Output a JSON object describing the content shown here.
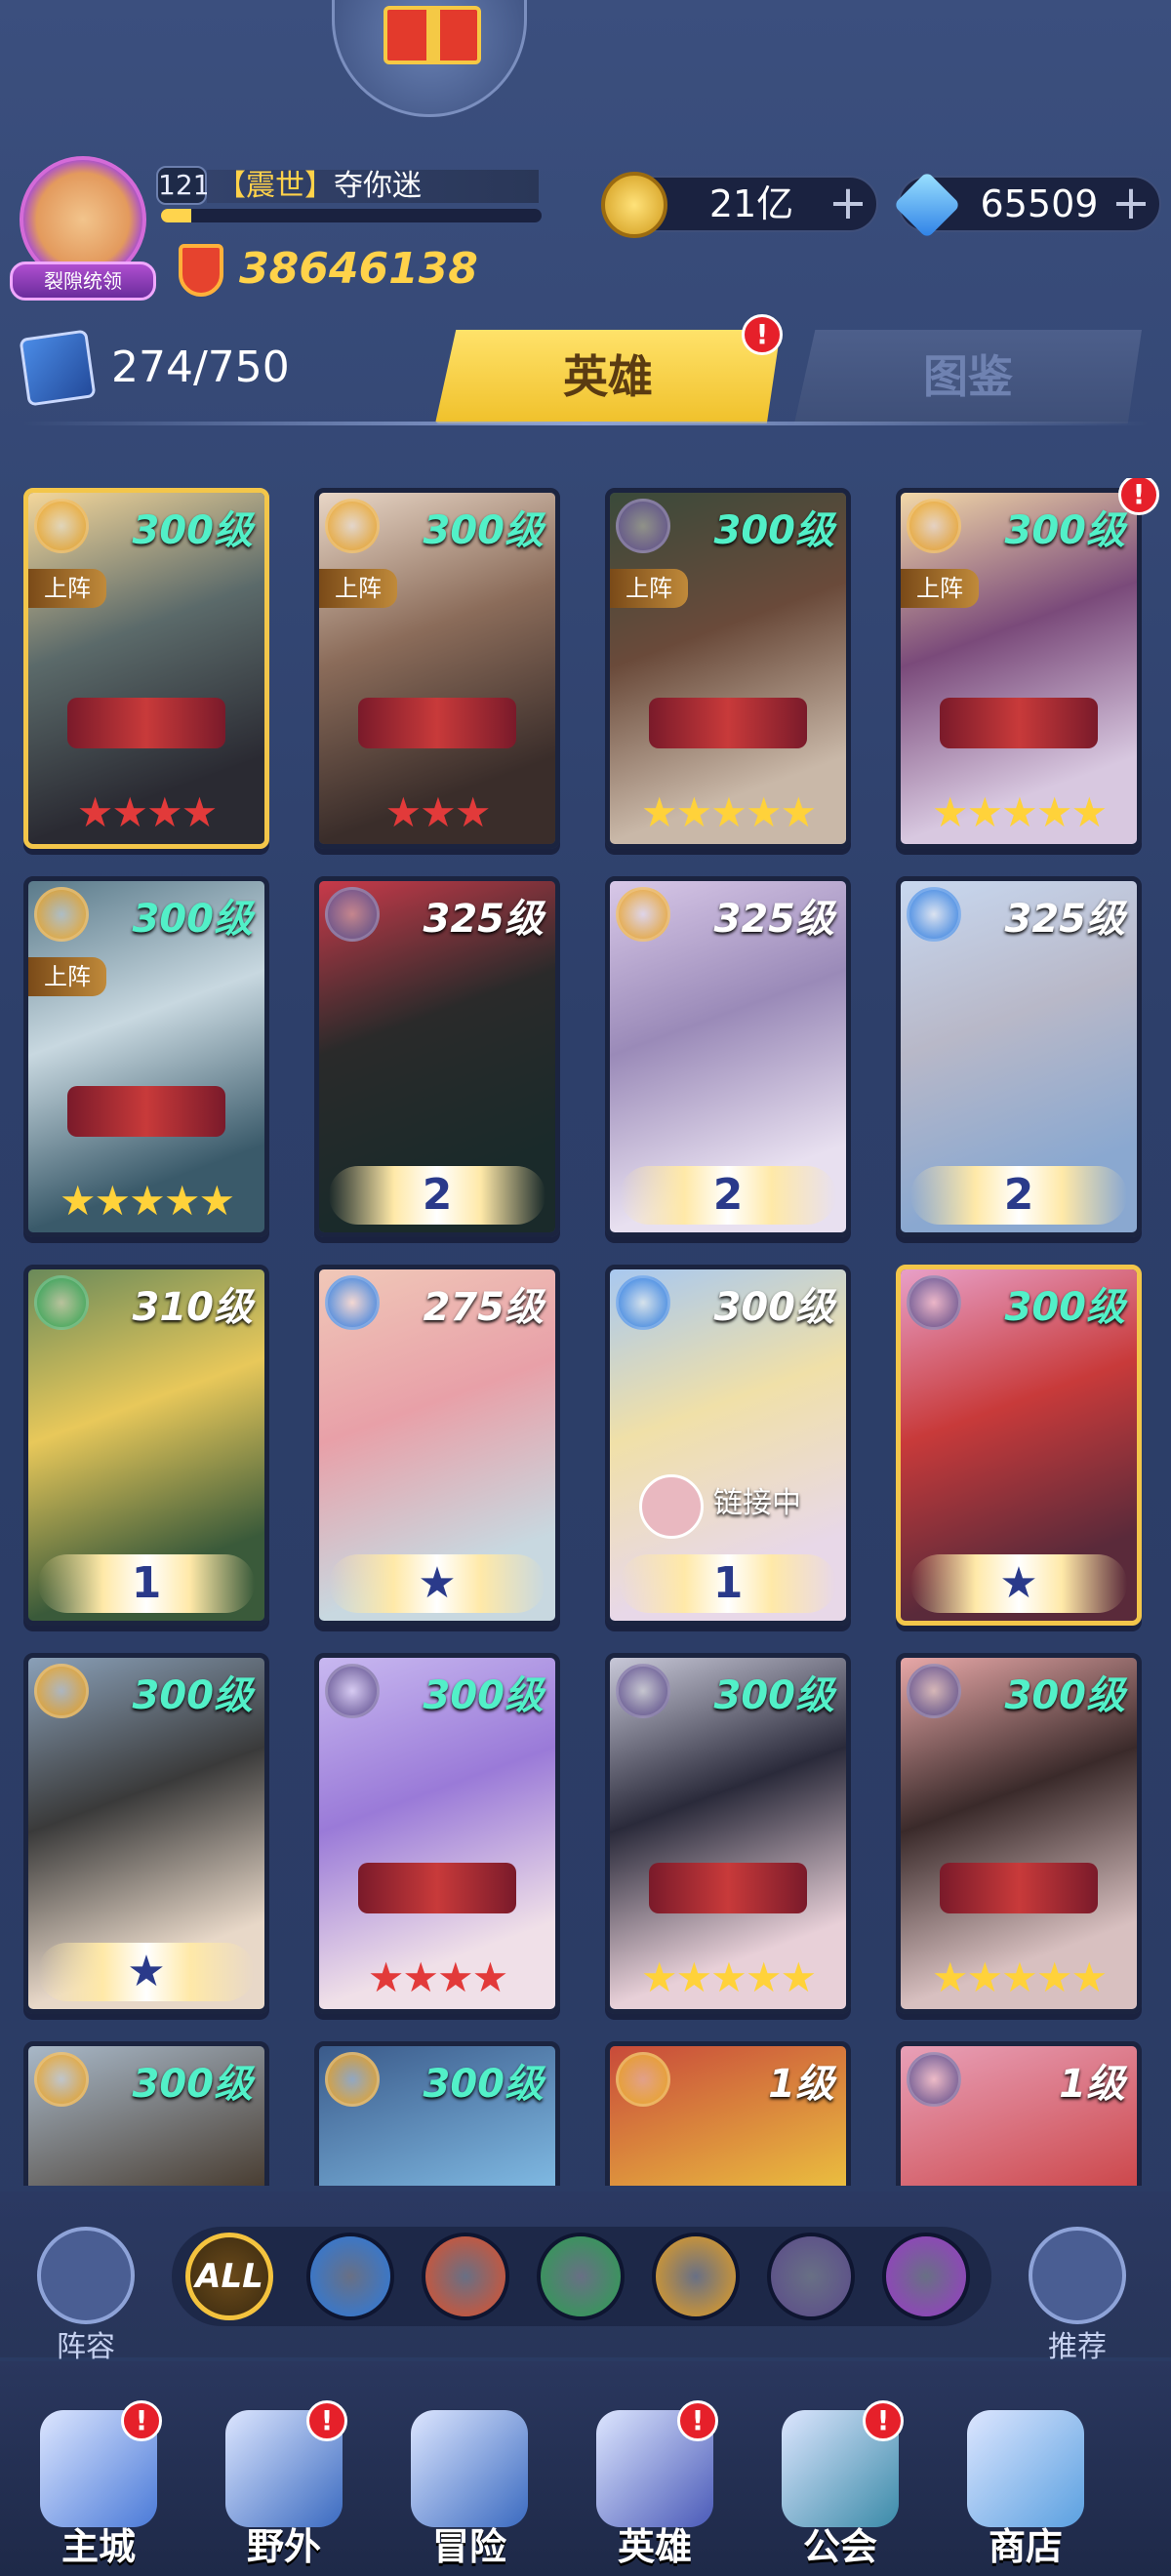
{
  "header": {
    "avatar_title": "裂隙统领",
    "level": "121",
    "guild_tag": "【震世】",
    "player_name": "夺你迷",
    "xp_fraction": 0.08,
    "power": "38646138"
  },
  "resources": {
    "gold": "21亿",
    "diamonds": "65509",
    "plus": "+"
  },
  "collection": {
    "count": "274/750"
  },
  "tabs": {
    "heroes": "英雄",
    "guide": "图鉴",
    "badge": "!"
  },
  "heroes": [
    {
      "level": "300级",
      "element": "light",
      "deployed": "上阵",
      "stars": "★★★★",
      "star_color": "#e23a3a",
      "rank": "",
      "gold_frame": true,
      "badge": false,
      "link": "",
      "art": "linear-gradient(160deg,#f3d69a,#5b6a6a 40%,#2a2a32 80%)",
      "lvl_color": "#52f0c8"
    },
    {
      "level": "300级",
      "element": "light",
      "deployed": "上阵",
      "stars": "★★★",
      "star_color": "#e23a3a",
      "rank": "",
      "gold_frame": false,
      "badge": false,
      "link": "",
      "art": "linear-gradient(160deg,#e8d6c6,#8b6c5a 40%,#3a2d2a 80%)",
      "lvl_color": "#52f0c8"
    },
    {
      "level": "300级",
      "element": "dark",
      "deployed": "上阵",
      "stars": "★★★★★",
      "star_color": "#ffd23a",
      "rank": "",
      "gold_frame": false,
      "badge": false,
      "link": "",
      "art": "linear-gradient(160deg,#3a4a3a,#6a4a3a 40%,#c9b8a8 80%)",
      "lvl_color": "#52f0c8"
    },
    {
      "level": "300级",
      "element": "light",
      "deployed": "上阵",
      "stars": "★★★★★",
      "star_color": "#ffd23a",
      "rank": "",
      "gold_frame": false,
      "badge": true,
      "link": "",
      "art": "linear-gradient(160deg,#f2d8a8,#7a4a7a 40%,#d8c8e0 80%)",
      "lvl_color": "#52f0c8"
    },
    {
      "level": "300级",
      "element": "light",
      "deployed": "上阵",
      "stars": "★★★★★",
      "star_color": "#ffd23a",
      "rank": "",
      "gold_frame": false,
      "badge": false,
      "link": "",
      "art": "linear-gradient(160deg,#5a7a8a,#c8d8e0 40%,#3a5a6a 80%)",
      "lvl_color": "#52f0c8"
    },
    {
      "level": "325级",
      "element": "dark",
      "deployed": "",
      "stars": "",
      "star_color": "",
      "rank": "2",
      "gold_frame": false,
      "badge": false,
      "link": "",
      "art": "linear-gradient(160deg,#c83a4a,#2a2a2a 40%,#1a2a2a 80%)",
      "lvl_color": "#ffffff"
    },
    {
      "level": "325级",
      "element": "light",
      "deployed": "",
      "stars": "",
      "star_color": "",
      "rank": "2",
      "gold_frame": false,
      "badge": false,
      "link": "",
      "art": "linear-gradient(160deg,#d8c8e8,#9a8ab8 40%,#e8e0f0 80%)",
      "lvl_color": "#ffffff"
    },
    {
      "level": "325级",
      "element": "water",
      "deployed": "",
      "stars": "",
      "star_color": "",
      "rank": "2",
      "gold_frame": false,
      "badge": false,
      "link": "",
      "art": "linear-gradient(160deg,#c8d8f0,#b8b8c8 40%,#8aa8d0 80%)",
      "lvl_color": "#ffffff"
    },
    {
      "level": "310级",
      "element": "wind",
      "deployed": "",
      "stars": "",
      "star_color": "",
      "rank": "1",
      "gold_frame": false,
      "badge": false,
      "link": "",
      "art": "linear-gradient(160deg,#6a8a5a,#e8c85a 40%,#3a5a3a 80%)",
      "lvl_color": "#ffffff"
    },
    {
      "level": "275级",
      "element": "water",
      "deployed": "",
      "stars": "",
      "star_color": "",
      "rank": "★",
      "gold_frame": false,
      "badge": false,
      "link": "",
      "art": "linear-gradient(160deg,#f0c8b8,#e8a0a8 40%,#c8d8e0 80%)",
      "lvl_color": "#ffffff"
    },
    {
      "level": "300级",
      "element": "water",
      "deployed": "",
      "stars": "",
      "star_color": "",
      "rank": "1",
      "gold_frame": false,
      "badge": false,
      "link": "链接中",
      "art": "linear-gradient(160deg,#a8c8f0,#f0e0a8 40%,#e8d8e8 80%)",
      "lvl_color": "#ffffff"
    },
    {
      "level": "300级",
      "element": "dark",
      "deployed": "",
      "stars": "",
      "star_color": "",
      "rank": "★",
      "gold_frame": true,
      "badge": false,
      "link": "",
      "art": "linear-gradient(160deg,#e8a0c8,#c83a3a 40%,#5a2a3a 80%)",
      "lvl_color": "#52f0c8"
    },
    {
      "level": "300级",
      "element": "light",
      "deployed": "",
      "stars": "",
      "star_color": "",
      "rank": "★",
      "gold_frame": false,
      "badge": false,
      "link": "",
      "art": "linear-gradient(160deg,#8aa0b8,#3a3a3a 40%,#e8d8c8 80%)",
      "lvl_color": "#52f0c8"
    },
    {
      "level": "300级",
      "element": "dark",
      "deployed": "",
      "stars": "★★★★",
      "star_color": "#e23a3a",
      "rank": "",
      "gold_frame": false,
      "badge": false,
      "link": "",
      "art": "linear-gradient(160deg,#c8b8f0,#9a7ad8 40%,#f0e0e8 80%)",
      "lvl_color": "#52f0c8"
    },
    {
      "level": "300级",
      "element": "dark",
      "deployed": "",
      "stars": "★★★★★",
      "star_color": "#ffd23a",
      "rank": "",
      "gold_frame": false,
      "badge": false,
      "link": "",
      "art": "linear-gradient(160deg,#c8c8d8,#2a2a3a 40%,#e8d0d8 80%)",
      "lvl_color": "#52f0c8"
    },
    {
      "level": "300级",
      "element": "dark",
      "deployed": "",
      "stars": "★★★★★",
      "star_color": "#ffd23a",
      "rank": "",
      "gold_frame": false,
      "badge": false,
      "link": "",
      "art": "linear-gradient(160deg,#e8a8a8,#3a2a2a 40%,#d8c0c0 80%)",
      "lvl_color": "#52f0c8"
    },
    {
      "level": "300级",
      "element": "light",
      "deployed": "",
      "stars": "",
      "star_color": "",
      "rank": "",
      "gold_frame": false,
      "badge": false,
      "link": "",
      "art": "linear-gradient(160deg,#a8b8c8,#3a2a1a 60%)",
      "lvl_color": "#52f0c8"
    },
    {
      "level": "300级",
      "element": "light",
      "deployed": "",
      "stars": "",
      "star_color": "",
      "rank": "",
      "gold_frame": false,
      "badge": false,
      "link": "",
      "art": "linear-gradient(160deg,#3a5a8a,#8ac8f0 60%)",
      "lvl_color": "#52f0c8"
    },
    {
      "level": "1级",
      "element": "light",
      "deployed": "",
      "stars": "",
      "star_color": "",
      "rank": "",
      "gold_frame": false,
      "badge": false,
      "link": "",
      "art": "linear-gradient(160deg,#c84a3a,#f0d040 60%)",
      "lvl_color": "#ffffff"
    },
    {
      "level": "1级",
      "element": "dark",
      "deployed": "",
      "stars": "",
      "star_color": "",
      "rank": "",
      "gold_frame": false,
      "badge": false,
      "link": "",
      "art": "linear-gradient(160deg,#e8a0b8,#c83a3a 60%)",
      "lvl_color": "#ffffff"
    }
  ],
  "element_colors": {
    "light": "#e8a020",
    "dark": "#5a4a8a",
    "water": "#2a7ae0",
    "wind": "#2aa050",
    "fire": "#e0502a",
    "arcane": "#9a3ac8"
  },
  "filters": {
    "lineup": "阵容",
    "recommend": "推荐",
    "all": "ALL",
    "elements": [
      "water",
      "fire",
      "wind",
      "light",
      "dark",
      "arcane"
    ]
  },
  "nav": [
    {
      "label": "主城",
      "badge": true,
      "color": "#4a7ad8"
    },
    {
      "label": "野外",
      "badge": true,
      "color": "#3a6ac0"
    },
    {
      "label": "冒险",
      "badge": false,
      "color": "#3a6ac0"
    },
    {
      "label": "英雄",
      "badge": true,
      "color": "#4a5ab8"
    },
    {
      "label": "公会",
      "badge": true,
      "color": "#3a8aa8"
    },
    {
      "label": "商店",
      "badge": false,
      "color": "#5aa0e0"
    }
  ]
}
